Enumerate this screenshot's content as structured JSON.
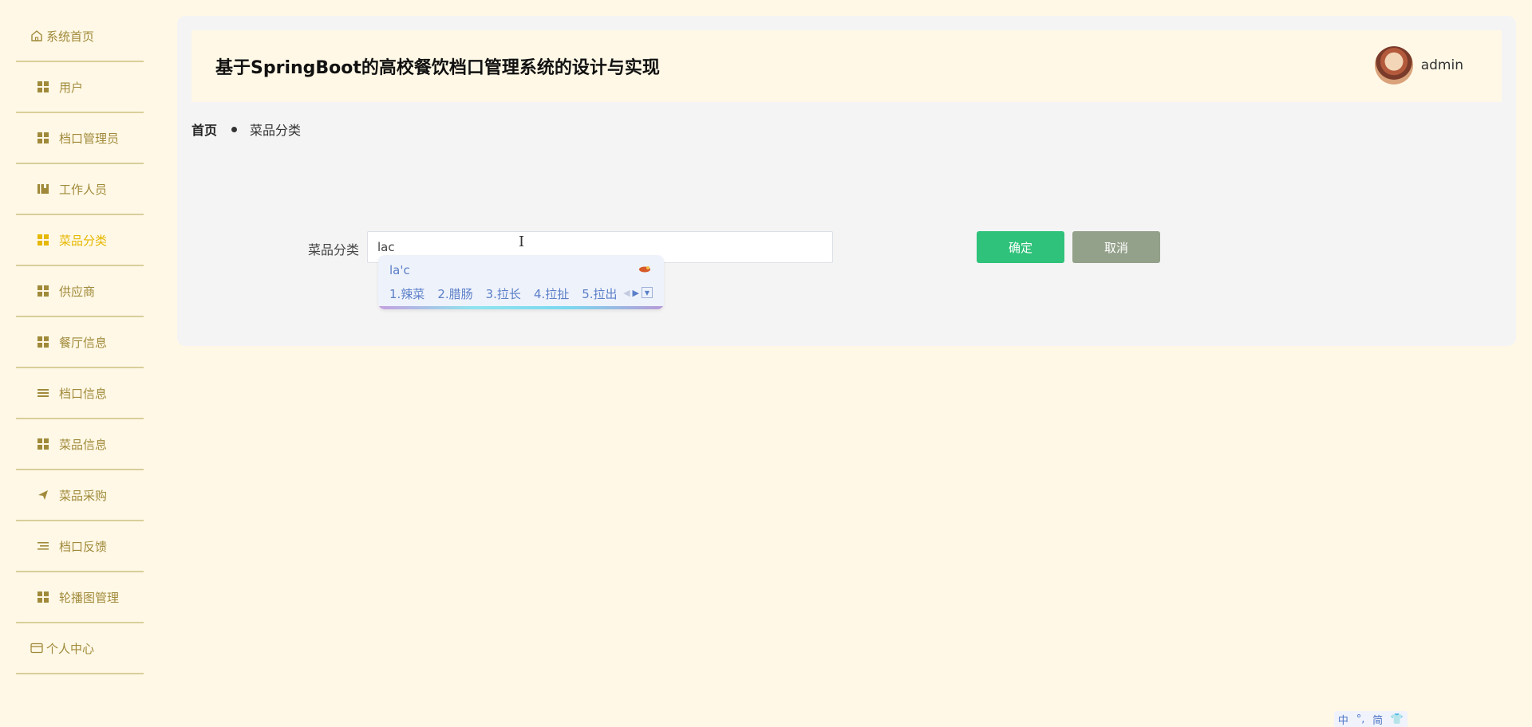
{
  "sidebar": {
    "items": [
      {
        "label": "系统首页",
        "icon": "home-icon",
        "type": "top"
      },
      {
        "label": "用户",
        "icon": "grid-icon",
        "type": "sub"
      },
      {
        "label": "档口管理员",
        "icon": "grid-icon",
        "type": "sub"
      },
      {
        "label": "工作人员",
        "icon": "book-icon",
        "type": "sub"
      },
      {
        "label": "菜品分类",
        "icon": "grid-icon",
        "type": "sub",
        "active": true
      },
      {
        "label": "供应商",
        "icon": "grid-icon",
        "type": "sub"
      },
      {
        "label": "餐厅信息",
        "icon": "grid-icon",
        "type": "sub"
      },
      {
        "label": "档口信息",
        "icon": "list-icon",
        "type": "sub"
      },
      {
        "label": "菜品信息",
        "icon": "grid-icon",
        "type": "sub"
      },
      {
        "label": "菜品采购",
        "icon": "send-icon",
        "type": "sub"
      },
      {
        "label": "档口反馈",
        "icon": "list-indent-icon",
        "type": "sub"
      },
      {
        "label": "轮播图管理",
        "icon": "grid-icon",
        "type": "sub"
      },
      {
        "label": "个人中心",
        "icon": "card-icon",
        "type": "top"
      }
    ]
  },
  "header": {
    "title": "基于SpringBoot的高校餐饮档口管理系统的设计与实现",
    "username": "admin"
  },
  "breadcrumb": {
    "home": "首页",
    "current": "菜品分类"
  },
  "form": {
    "label": "菜品分类",
    "value": "lac",
    "confirm": "确定",
    "cancel": "取消"
  },
  "ime": {
    "pinyin": "la'c",
    "candidates": [
      "1.辣菜",
      "2.腊肠",
      "3.拉长",
      "4.拉扯",
      "5.拉出"
    ]
  },
  "ime_status": [
    "中",
    "°,",
    "简",
    "👕"
  ],
  "colors": {
    "page_bg": "#fff8e6",
    "nav_text": "#a08a3a",
    "nav_active": "#e6b800",
    "confirm": "#2fc27a",
    "cancel": "#93a08a"
  }
}
